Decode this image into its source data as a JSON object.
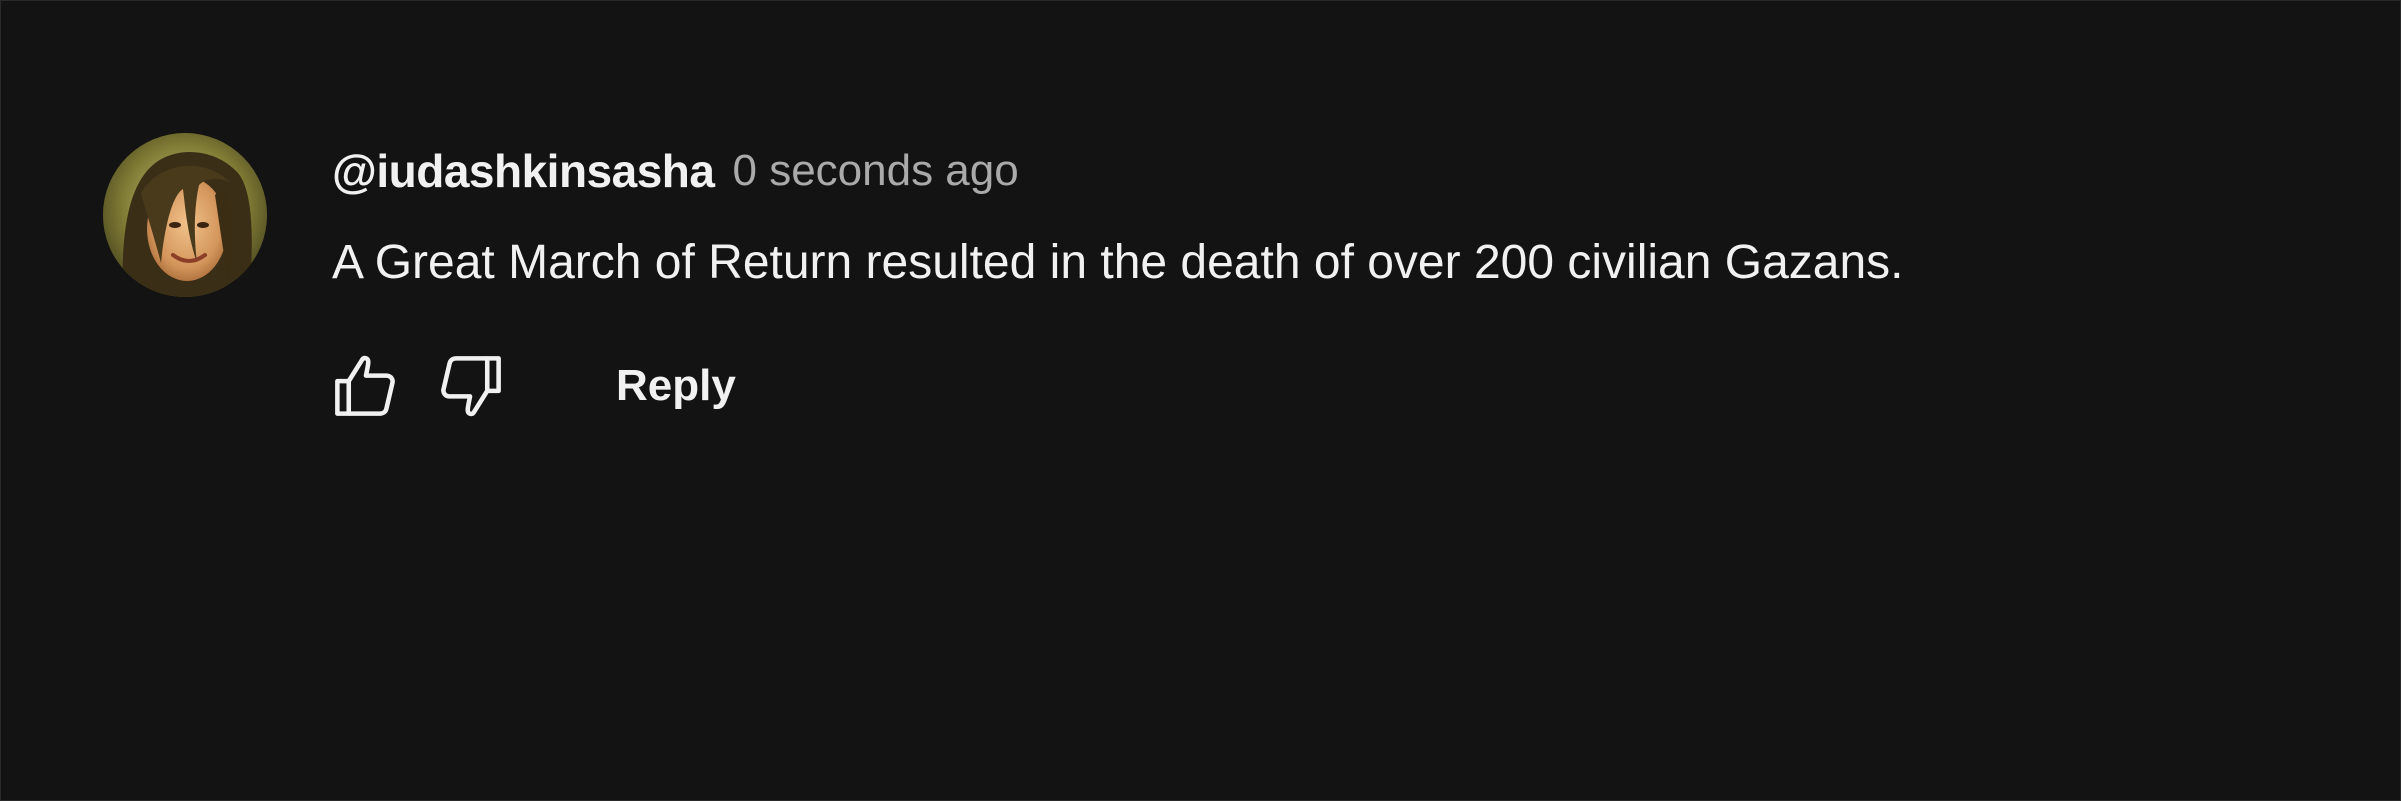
{
  "comment": {
    "author": "@iudashkinsasha",
    "timestamp": "0 seconds ago",
    "text": "A Great March of Return resulted in the death of over 200 civilian Gazans.",
    "avatar_icon": "user-avatar-photo"
  },
  "actions": {
    "like_icon": "thumbs-up-icon",
    "dislike_icon": "thumbs-down-icon",
    "reply_label": "Reply"
  },
  "colors": {
    "background": "#131313",
    "primary_text": "#f1f1f1",
    "secondary_text": "#aaaaaa"
  }
}
